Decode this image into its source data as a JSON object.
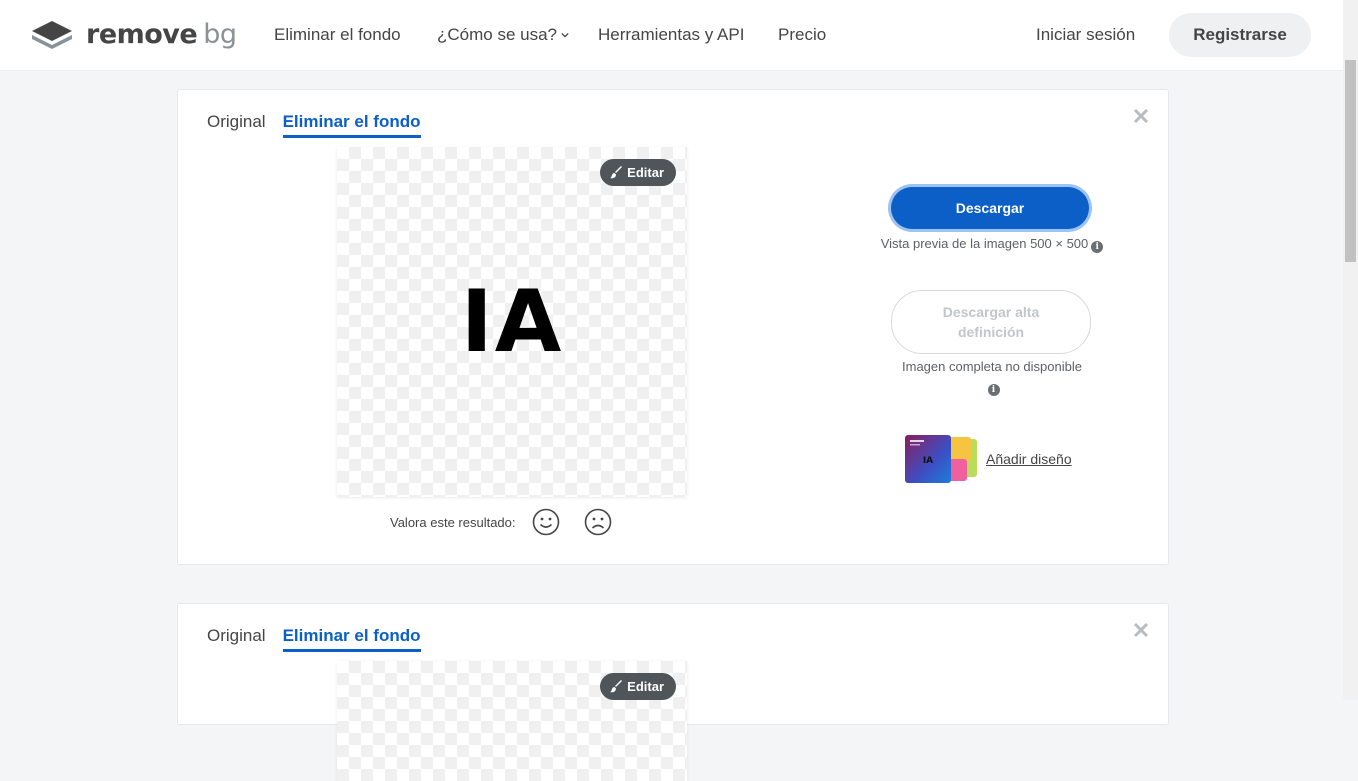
{
  "header": {
    "logo_text": "remove",
    "logo_text_bg": "bg",
    "nav": [
      "Eliminar el fondo",
      "¿Cómo se usa?",
      "Herramientas y API",
      "Precio"
    ],
    "login": "Iniciar sesión",
    "register": "Registrarse"
  },
  "cards": [
    {
      "tab_original": "Original",
      "tab_remove": "Eliminar el fondo",
      "preview_text": "IA",
      "edit_label": "Editar",
      "rate_label": "Valora este resultado:",
      "download_label": "Descargar",
      "preview_note": "Vista previa de la imagen 500 × 500",
      "hd_label": "Descargar alta definición",
      "hd_note": "Imagen completa no disponible",
      "design_thumb_text": "IA",
      "add_design": "Añadir diseño"
    },
    {
      "tab_original": "Original",
      "tab_remove": "Eliminar el fondo",
      "edit_label": "Editar"
    }
  ],
  "colors": {
    "accent": "#0b5fc6",
    "page_bg": "#f3f5f7",
    "text": "#454545"
  }
}
